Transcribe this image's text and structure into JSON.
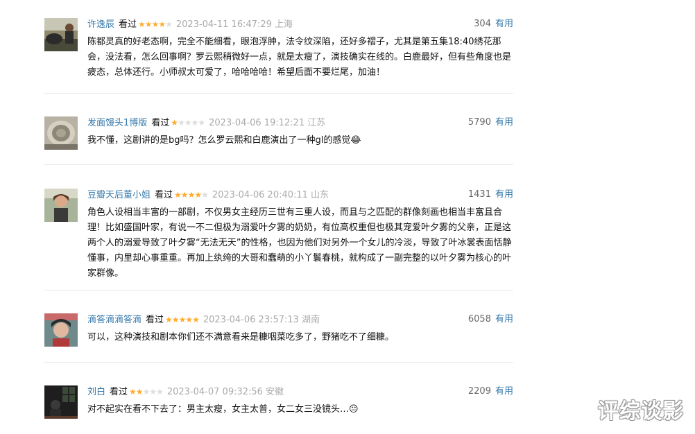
{
  "comments": [
    {
      "user": "许逸辰",
      "status": "看过",
      "rating": 4,
      "time": "2023-04-11 16:47:29",
      "location": "上海",
      "votes": "304",
      "useful_label": "有用",
      "text": "陈都灵真的好老态啊，完全不能细看，眼泡浮肿，法令纹深陷，还好多褶子，尤其是第五集18:40绣花那会，没法看，怎么回事啊？罗云熙稍微好一点，就是太瘦了，演技确实在线的。白鹿最好，但有些角度也是疲态，总体还行。小师叔太可爱了，哈哈哈哈！希望后面不要烂尾，加油！"
    },
    {
      "user": "发面馒头1博版",
      "status": "看过",
      "rating": 1,
      "time": "2023-04-06 19:12:21",
      "location": "江苏",
      "votes": "5790",
      "useful_label": "有用",
      "text": "我不懂，这剧讲的是bg吗？怎么罗云熙和白鹿演出了一种gl的感觉😂"
    },
    {
      "user": "豆瓣天后董小姐",
      "status": "看过",
      "rating": 4,
      "time": "2023-04-06 20:40:11",
      "location": "山东",
      "votes": "1431",
      "useful_label": "有用",
      "text": "角色人设相当丰富的一部剧，不仅男女主经历三世有三重人设，而且与之匹配的群像刻画也相当丰富且合理！比如盛国叶家，有说一不二但极为溺爱叶夕雾的奶奶，有位高权重但也极其宠爱叶夕雾的父亲，正是这两个人的溺爱导致了叶夕雾“无法无天”的性格，也因为他们对另外一个女儿的冷淡，导致了叶冰裳表面恬静懂事，内里却心事重重。再加上纨绔的大哥和蠢萌的小丫鬟春桃，就构成了一副完整的以叶夕雾为核心的叶家群像。"
    },
    {
      "user": "滴答滴滴答滴",
      "status": "看过",
      "rating": 5,
      "time": "2023-04-06 23:57:13",
      "location": "湖南",
      "votes": "6058",
      "useful_label": "有用",
      "text": "可以，这种演技和剧本你们还不满意看来是糠咽菜吃多了，野猪吃不了细糠。"
    },
    {
      "user": "刘白",
      "status": "看过",
      "rating": 2,
      "time": "2023-04-07 09:32:56",
      "location": "安徽",
      "votes": "2209",
      "useful_label": "有用",
      "text": "对不起实在看不下去了：男主太瘦，女主太普，女二女三没镜头…😐"
    }
  ],
  "watermark": "评综谈影",
  "colors": {
    "link": "#3377aa",
    "star_on": "#ffac2d",
    "star_off": "#dddddd",
    "muted": "#aaaaaa",
    "divider": "#e8e8e8"
  }
}
